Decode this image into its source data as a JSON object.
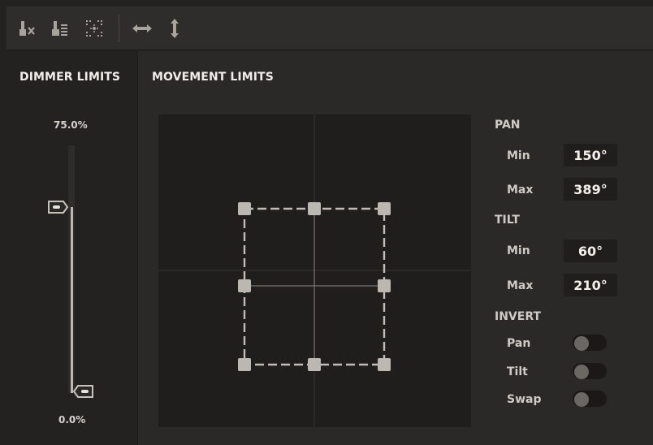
{
  "toolbar": {
    "buttons": [
      {
        "icon": "dimmer-off-icon"
      },
      {
        "icon": "dimmer-dots-icon"
      },
      {
        "icon": "focus-center-icon"
      },
      {
        "icon": "horizontal-flip-icon"
      },
      {
        "icon": "vertical-flip-icon"
      }
    ]
  },
  "dimmer": {
    "title": "DIMMER LIMITS",
    "max_label": "75.0%",
    "min_label": "0.0%",
    "max_value": 0.75,
    "min_value": 0.0
  },
  "movement": {
    "title": "MOVEMENT LIMITS",
    "pan_label": "PAN",
    "tilt_label": "TILT",
    "min_label": "Min",
    "max_label": "Max",
    "pan_min": "150°",
    "pan_max": "389°",
    "tilt_min": "60°",
    "tilt_max": "210°",
    "invert_label": "INVERT",
    "invert_pan_label": "Pan",
    "invert_tilt_label": "Tilt",
    "invert_swap_label": "Swap",
    "invert_pan": false,
    "invert_tilt": false,
    "invert_swap": false,
    "colors": {
      "frame": "#c2bcb6",
      "grid": "#3a3836",
      "crosshair": "#8d8883"
    }
  }
}
